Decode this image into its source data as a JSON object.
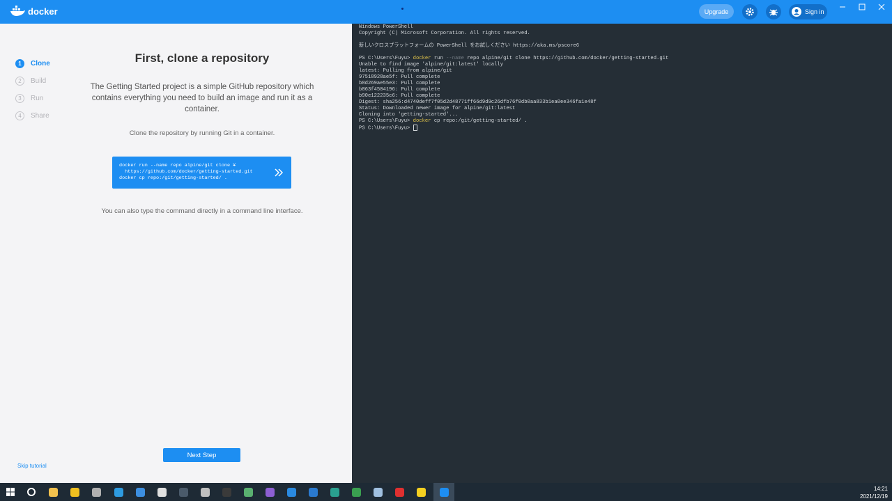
{
  "app": {
    "name": "docker"
  },
  "titlebar": {
    "upgrade_label": "Upgrade",
    "signin_label": "Sign in"
  },
  "steps": [
    {
      "num": "1",
      "label": "Clone",
      "active": true
    },
    {
      "num": "2",
      "label": "Build",
      "active": false
    },
    {
      "num": "3",
      "label": "Run",
      "active": false
    },
    {
      "num": "4",
      "label": "Share",
      "active": false
    }
  ],
  "main": {
    "heading": "First, clone a repository",
    "description": "The Getting Started project is a simple GitHub repository which contains everything you need to build an image and run it as a container.",
    "instruction": "Clone the repository by running Git in a container.",
    "command": "docker run --name repo alpine/git clone ¥\n  https://github.com/docker/getting-started.git\ndocker cp repo:/git/getting-started/ .",
    "also": "You can also type the command directly in a command line interface.",
    "next_label": "Next Step",
    "skip_label": "Skip tutorial"
  },
  "terminal": {
    "lines": [
      "Windows PowerShell",
      "Copyright (C) Microsoft Corporation. All rights reserved.",
      "",
      "新しいクロスプラットフォームの PowerShell をお試しください https://aka.ms/pscore6",
      "",
      "PS C:\\Users\\Fuyu> ",
      "Unable to find image 'alpine/git:latest' locally",
      "latest: Pulling from alpine/git",
      "97518928ae5f: Pull complete",
      "b8d269ae55e3: Pull complete",
      "b863f4504196: Pull complete",
      "b90e122235c6: Pull complete",
      "Digest: sha256:d4740deff7f05d2d48771ff66d9d9c26dfb76f0db0aa833b1ea0ee346fa1e48f",
      "Status: Downloaded newer image for alpine/git:latest",
      "Cloning into 'getting-started'...",
      "PS C:\\Users\\Fuyu> ",
      "PS C:\\Users\\Fuyu> "
    ],
    "cmd1": {
      "cmd": "docker",
      "a": " run ",
      "flag": "--name",
      "b": " repo alpine/git clone https://github.com/docker/getting-started.git"
    },
    "cmd2": {
      "cmd": "docker",
      "rest": " cp repo:/git/getting-started/ ."
    }
  },
  "taskbar": {
    "time": "14:21",
    "date": "2021/12/19",
    "apps": [
      {
        "name": "search-icon",
        "color": "#ffffff"
      },
      {
        "name": "file-explorer-icon",
        "color": "#f2c14e"
      },
      {
        "name": "app-yellow-icon",
        "color": "#f0c020"
      },
      {
        "name": "apple-icon",
        "color": "#b0b0b0"
      },
      {
        "name": "edge-icon",
        "color": "#2e9be0"
      },
      {
        "name": "chrome-icon",
        "color": "#3d8fe0"
      },
      {
        "name": "notion-icon",
        "color": "#e0e0e0"
      },
      {
        "name": "app-dark-icon",
        "color": "#4a5a6a"
      },
      {
        "name": "obs-icon",
        "color": "#c0c0c0"
      },
      {
        "name": "waveform-icon",
        "color": "#3a3a3a"
      },
      {
        "name": "app-green-icon",
        "color": "#5ab070"
      },
      {
        "name": "visual-studio-icon",
        "color": "#8d5fd3"
      },
      {
        "name": "vscode-icon",
        "color": "#2a8ae0"
      },
      {
        "name": "mail-icon",
        "color": "#2a7ad0"
      },
      {
        "name": "app-teal-icon",
        "color": "#2aa090"
      },
      {
        "name": "app-green2-icon",
        "color": "#3aa050"
      },
      {
        "name": "app-light-icon",
        "color": "#a0c0e0"
      },
      {
        "name": "camera-icon",
        "color": "#e03030"
      },
      {
        "name": "sticky-notes-icon",
        "color": "#f5d020"
      },
      {
        "name": "docker-icon",
        "color": "#1d8ef2"
      }
    ]
  }
}
